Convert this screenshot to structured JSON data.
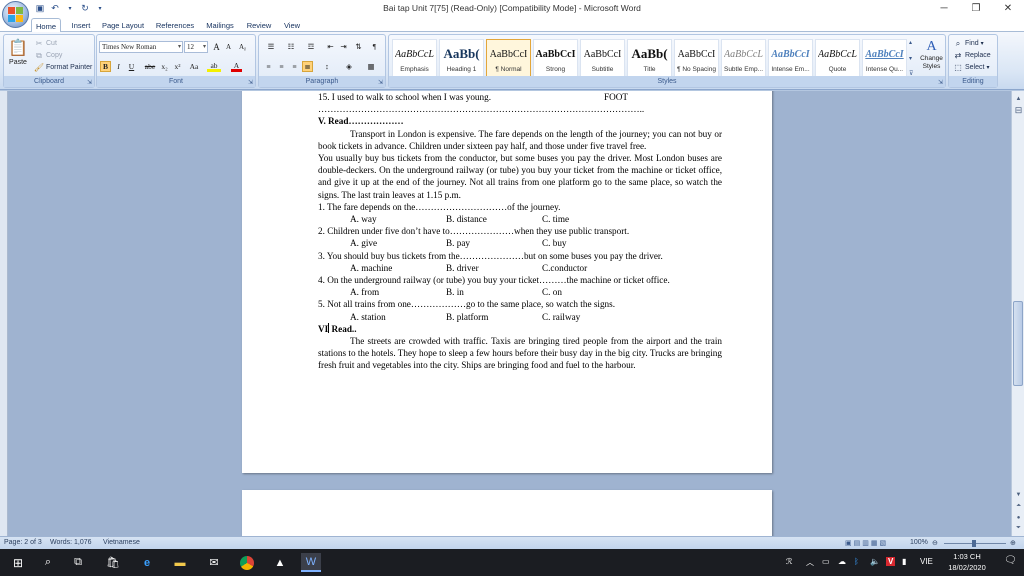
{
  "window": {
    "title": "Bai tap Unit 7[75] (Read-Only) [Compatibility Mode] - Microsoft Word",
    "controls": {
      "minimize": "─",
      "restore": "❐",
      "close": "✕"
    }
  },
  "tabs": [
    {
      "label": "Home",
      "active": true
    },
    {
      "label": "Insert"
    },
    {
      "label": "Page Layout"
    },
    {
      "label": "References"
    },
    {
      "label": "Mailings"
    },
    {
      "label": "Review"
    },
    {
      "label": "View"
    }
  ],
  "clipboard": {
    "paste": "Paste",
    "cut": "Cut",
    "copy": "Copy",
    "format_painter": "Format Painter",
    "label": "Clipboard"
  },
  "font": {
    "family": "Times New Roman",
    "size": "12",
    "label": "Font",
    "buttons": {
      "bold": "B",
      "italic": "I",
      "underline": "U",
      "strike": "abe",
      "sub": "x₂",
      "sup": "x²",
      "case": "Aa",
      "highlight": "ab",
      "color": "A",
      "grow": "A",
      "shrink": "A",
      "clear": "Aᵪ"
    }
  },
  "paragraph": {
    "label": "Paragraph"
  },
  "styles": {
    "label": "Styles",
    "items": [
      {
        "sample": "AaBbCcL",
        "name": "Emphasis"
      },
      {
        "sample": "AaBb(",
        "name": "Heading 1"
      },
      {
        "sample": "AaBbCcI",
        "name": "¶ Normal",
        "selected": true
      },
      {
        "sample": "AaBbCcI",
        "name": "Strong"
      },
      {
        "sample": "AaBbCcI",
        "name": "Subtitle"
      },
      {
        "sample": "AaBb(",
        "name": "Title"
      },
      {
        "sample": "AaBbCcI",
        "name": "¶ No Spacing"
      },
      {
        "sample": "AaBbCcL",
        "name": "Subtle Emp..."
      },
      {
        "sample": "AaBbCcI",
        "name": "Intense Em..."
      },
      {
        "sample": "AaBbCcL",
        "name": "Quote"
      },
      {
        "sample": "AaBbCcI",
        "name": "Intense Qu..."
      }
    ],
    "change_styles": "Change Styles"
  },
  "editing": {
    "label": "Editing",
    "find": "Find",
    "replace": "Replace",
    "select": "Select"
  },
  "document": {
    "line15": "15. I used to walk to school when I was young.",
    "line15_hint": "FOOT",
    "dots": "……………………………………………………………………………………………..",
    "section5": "V. Read………………",
    "p1": "Transport in London is expensive. The fare depends on the length of the journey; you can not buy or book tickets in advance. Children under sixteen pay half, and those under five travel free.",
    "p2": "You usually buy bus tickets from the conductor, but some buses you pay the driver. Most London buses are double-deckers. On the underground railway (or tube) you buy your ticket from the machine or ticket office, and give it up at the end of the journey. Not all trains from one platform go to the same place, so watch the signs. The last train leaves at 1.15 p.m.",
    "questions": [
      {
        "q": "1. The fare depends on the…………………………of the journey.",
        "a": "A. way",
        "b": "B. distance",
        "c": "C. time"
      },
      {
        "q": "2. Children under five don’t have to…………………when they use public transport.",
        "a": "A. give",
        "b": "B. pay",
        "c": "C. buy"
      },
      {
        "q": "3. You should buy bus tickets from the…………………but on some buses you pay the driver.",
        "a": "A. machine",
        "b": "B. driver",
        "c": "C.conductor"
      },
      {
        "q": "4. On the underground railway (or tube) you buy your ticket………the machine or ticket office.",
        "a": "A. from",
        "b": "B. in",
        "c": "C. on"
      },
      {
        "q": "5. Not all trains from one………………go to the same place, so watch the signs.",
        "a": "A. station",
        "b": "B. platform",
        "c": "C. railway"
      }
    ],
    "section6_a": "VI",
    "section6_b": " Read..",
    "p3": "The streets are crowded with traffic. Taxis are bringing tired people from the airport and the train stations to the hotels. They hope to sleep a few hours before their busy day in the big city. Trucks are bringing fresh fruit and vegetables into the city. Ships are bringing food and fuel to the harbour."
  },
  "status": {
    "page": "Page: 2 of 3",
    "words": "Words: 1,076",
    "language": "Vietnamese",
    "zoom": "100%"
  },
  "taskbar": {
    "time": "1:03 CH",
    "date": "18/02/2020",
    "lang": "VIE"
  },
  "colors": {
    "accent": "#15315e",
    "ribbon": "#dae6f5",
    "taskbar": "#1b1d22",
    "selected_style": "#e3a63a"
  }
}
